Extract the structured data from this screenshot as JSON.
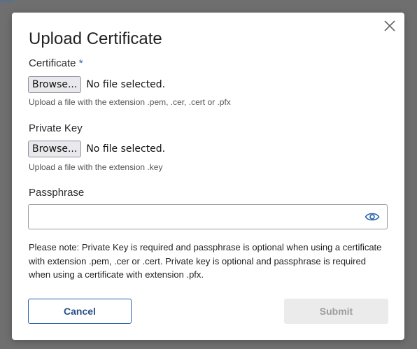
{
  "dialog": {
    "title": "Upload Certificate",
    "close_icon": "close-icon"
  },
  "certificate": {
    "label": "Certificate",
    "required_mark": "*",
    "browse_label": "Browse...",
    "file_status": "No file selected.",
    "hint": "Upload a file with the extension .pem, .cer, .cert or .pfx"
  },
  "private_key": {
    "label": "Private Key",
    "browse_label": "Browse...",
    "file_status": "No file selected.",
    "hint": "Upload a file with the extension .key"
  },
  "passphrase": {
    "label": "Passphrase",
    "value": "",
    "toggle_icon": "eye-icon"
  },
  "note": "Please note: Private Key is required and passphrase is optional when using a certificate with extension .pem, .cer or .cert. Private key is optional and passphrase is required when using a certificate with extension .pfx.",
  "actions": {
    "cancel_label": "Cancel",
    "submit_label": "Submit",
    "submit_disabled": true
  },
  "colors": {
    "accent": "#2a63a8",
    "overlay": "#6f6f6f",
    "disabled_bg": "#ebebeb",
    "disabled_text": "#9c9c9c"
  }
}
